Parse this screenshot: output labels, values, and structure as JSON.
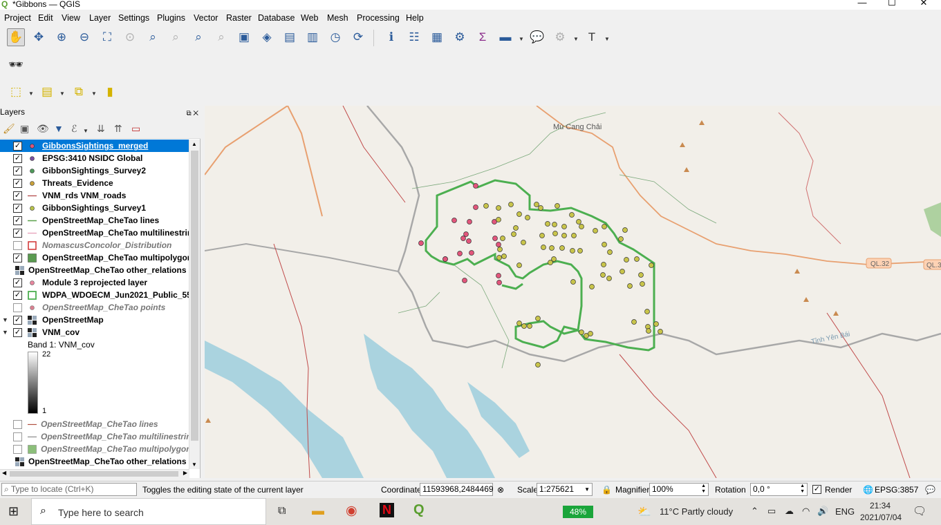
{
  "window": {
    "title": "*Gibbons — QGIS",
    "minimize": "—",
    "maximize": "☐",
    "close": "✕"
  },
  "menu": [
    "Project",
    "Edit",
    "View",
    "Layer",
    "Settings",
    "Plugins",
    "Vector",
    "Raster",
    "Database",
    "Web",
    "Mesh",
    "Processing",
    "Help"
  ],
  "layers_panel": {
    "title": "Layers",
    "items": [
      {
        "name": "GibbonsSightings_merged",
        "checked": "✓",
        "selected": true,
        "symbol": "point",
        "color": "#d9557a"
      },
      {
        "name": "EPSG:3410 NSIDC Global",
        "checked": "✓",
        "symbol": "point",
        "color": "#7a4fa0"
      },
      {
        "name": "GibbonSightings_Survey2",
        "checked": "✓",
        "symbol": "point",
        "color": "#4f9a5a"
      },
      {
        "name": "Threats_Evidence",
        "checked": "✓",
        "symbol": "point",
        "color": "#c9a13a"
      },
      {
        "name": "VNM_rds VNM_roads",
        "checked": "✓",
        "symbol": "line",
        "color": "#b04040"
      },
      {
        "name": "GibbonSightings_Survey1",
        "checked": "✓",
        "symbol": "point",
        "color": "#b8c24a"
      },
      {
        "name": "OpenStreetMap_CheTao lines",
        "checked": "✓",
        "symbol": "line",
        "color": "#5aa04a"
      },
      {
        "name": "OpenStreetMap_CheTao multilinestring",
        "checked": "✓",
        "symbol": "line",
        "color": "#e59ab4"
      },
      {
        "name": "NomascusConcolor_Distribution",
        "checked": "",
        "symbol": "poly-outline",
        "color": "#d03030",
        "italic": true
      },
      {
        "name": "OpenStreetMap_CheTao multipolygons",
        "checked": "✓",
        "symbol": "poly",
        "color": "#5a9a50"
      },
      {
        "name": "OpenStreetMap_CheTao other_relations",
        "checked": "✓",
        "symbol": "raster",
        "color": "#000000",
        "nocheck": true
      },
      {
        "name": "Module 3 reprojected layer",
        "checked": "✓",
        "symbol": "point",
        "color": "#e7869e"
      },
      {
        "name": "WDPA_WDOECM_Jun2021_Public_5555",
        "checked": "✓",
        "symbol": "poly-outline",
        "color": "#4caf50"
      },
      {
        "name": "OpenStreetMap_CheTao points",
        "checked": "",
        "symbol": "point",
        "color": "#d98090",
        "italic": true
      },
      {
        "name": "OpenStreetMap",
        "checked": "✓",
        "symbol": "raster",
        "color": "#000000",
        "expand": "▼"
      },
      {
        "name": "VNM_cov",
        "checked": "✓",
        "symbol": "raster",
        "color": "#000000",
        "expand": "▼"
      }
    ],
    "band_label": "Band 1: VNM_cov",
    "band_max": "22",
    "band_min": "1",
    "group_items": [
      {
        "name": "OpenStreetMap_CheTao lines",
        "symbol": "line",
        "color": "#b05040"
      },
      {
        "name": "OpenStreetMap_CheTao multilinestring",
        "symbol": "line",
        "color": "#888888"
      },
      {
        "name": "OpenStreetMap_CheTao multipolygons",
        "symbol": "poly",
        "color": "#8cbf7a"
      }
    ],
    "last_item": "OpenStreetMap_CheTao other_relations"
  },
  "map": {
    "labels": {
      "town": "Mù Cang Chải",
      "road1": "QL.32",
      "road2": "QL.3",
      "province": "Tỉnh Yên Bái"
    },
    "colors": {
      "background": "#f2efe9",
      "water": "#aad3df",
      "boundary": "#4caf50",
      "road": "#e8a070",
      "admin": "#9b9b9b"
    }
  },
  "status": {
    "locate_placeholder": "Type to locate (Ctrl+K)",
    "message": "Toggles the editing state of the current layer",
    "coordinate_label": "Coordinate",
    "coordinate": "11593968,2484469",
    "scale_label": "Scale",
    "scale": "1:275621",
    "magnifier_label": "Magnifier",
    "magnifier": "100%",
    "rotation_label": "Rotation",
    "rotation": "0,0 °",
    "render_label": "Render",
    "crs": "EPSG:3857"
  },
  "taskbar": {
    "search_placeholder": "Type here to search",
    "battery": "48%",
    "weather": "11°C  Partly cloudy",
    "lang": "ENG",
    "time": "21:34",
    "date": "2021/07/04"
  }
}
